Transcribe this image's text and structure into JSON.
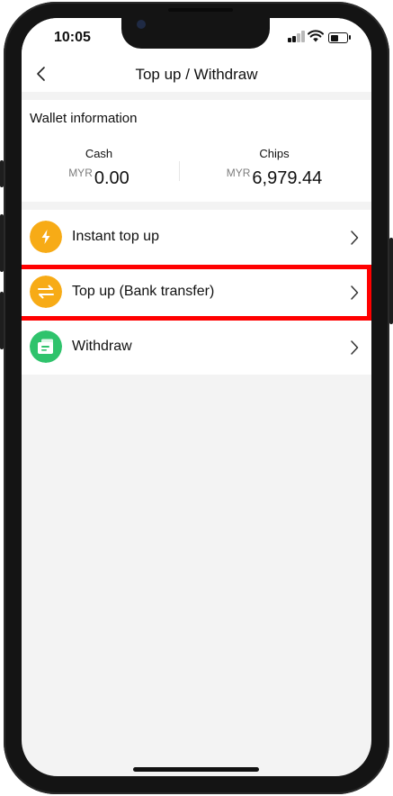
{
  "status_bar": {
    "time": "10:05"
  },
  "header": {
    "title": "Top up / Withdraw"
  },
  "wallet": {
    "title": "Wallet information",
    "cash": {
      "label": "Cash",
      "currency": "MYR",
      "amount": "0.00"
    },
    "chips": {
      "label": "Chips",
      "currency": "MYR",
      "amount": "6,979.44"
    }
  },
  "menu": {
    "items": [
      {
        "label": "Instant top up",
        "icon": "lightning-icon",
        "color": "#f7ab16"
      },
      {
        "label": "Top up (Bank transfer)",
        "icon": "transfer-arrows-icon",
        "color": "#f7ab16",
        "highlighted": true
      },
      {
        "label": "Withdraw",
        "icon": "wallet-icon",
        "color": "#2fc36c"
      }
    ]
  },
  "colors": {
    "highlight": "#ff0000",
    "page_bg": "#f3f3f3"
  }
}
